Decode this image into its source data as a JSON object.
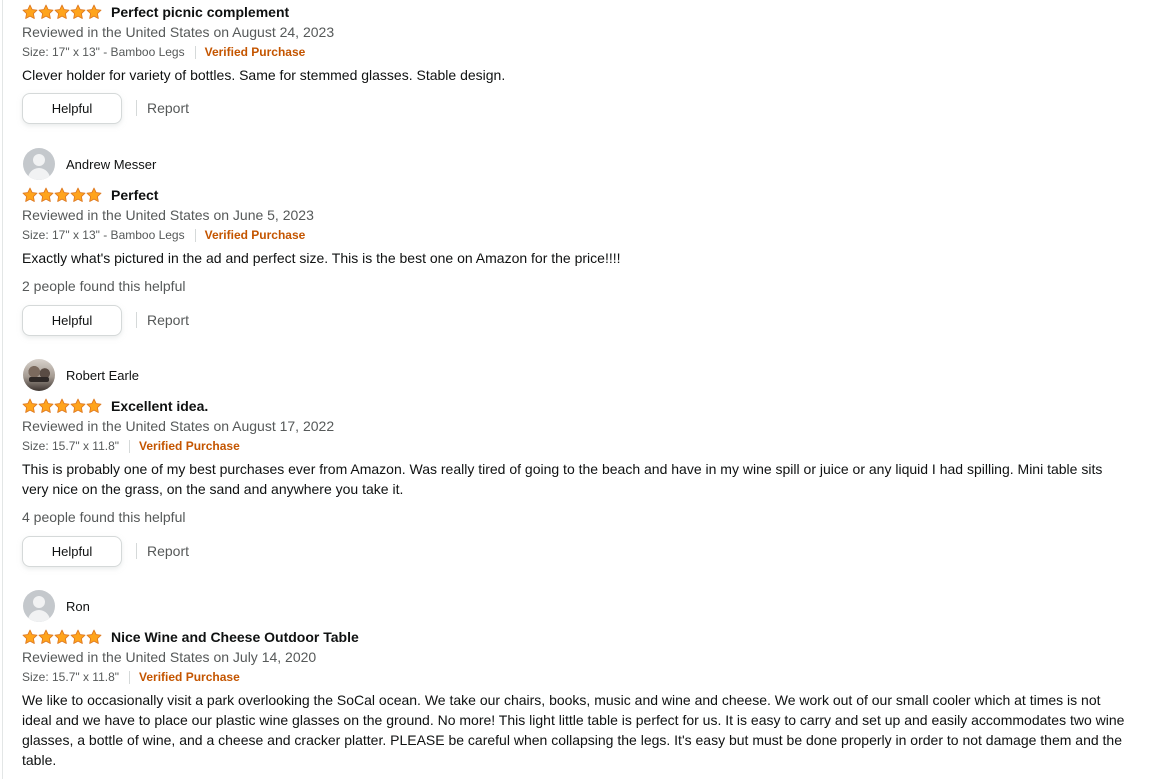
{
  "reviews": [
    {
      "title": "Perfect picnic complement",
      "date": "Reviewed in the United States on August 24, 2023",
      "size": "Size: 17\" x 13\" - Bamboo Legs",
      "verified": "Verified Purchase",
      "body": "Clever holder for variety of bottles. Same for stemmed glasses. Stable design.",
      "helpful_label": "Helpful",
      "report_label": "Report",
      "rating": 5
    },
    {
      "author": "Andrew Messer",
      "avatar": "default-avatar-icon",
      "title": "Perfect",
      "date": "Reviewed in the United States on June 5, 2023",
      "size": "Size: 17\" x 13\" - Bamboo Legs",
      "verified": "Verified Purchase",
      "body": "Exactly what's pictured in the ad and perfect size. This is the best one on Amazon for the price!!!!",
      "helpful_count": "2 people found this helpful",
      "helpful_label": "Helpful",
      "report_label": "Report",
      "rating": 5
    },
    {
      "author": "Robert Earle",
      "avatar": "photo-avatar",
      "title": "Excellent idea.",
      "date": "Reviewed in the United States on August 17, 2022",
      "size": "Size: 15.7\" x 11.8\"",
      "verified": "Verified Purchase",
      "body": "This is probably one of my best purchases ever from Amazon. Was really tired of going to the beach and have in my wine spill or juice or any liquid I had spilling. Mini table sits very nice on the grass, on the sand and anywhere you take it.",
      "helpful_count": "4 people found this helpful",
      "helpful_label": "Helpful",
      "report_label": "Report",
      "rating": 5
    },
    {
      "author": "Ron",
      "avatar": "default-avatar-icon",
      "title": "Nice Wine and Cheese Outdoor Table",
      "date": "Reviewed in the United States on July 14, 2020",
      "size": "Size: 15.7\" x 11.8\"",
      "verified": "Verified Purchase",
      "body": "We like to occasionally visit a park overlooking the SoCal ocean. We take our chairs, books, music and wine and cheese. We work out of our small cooler which at times is not ideal and we have to place our plastic wine glasses on the ground. No more! This light little table is perfect for us. It is easy to carry and set up and easily accommodates two wine glasses, a bottle of wine, and a cheese and cracker platter. PLEASE be careful when collapsing the legs. It's easy but must be done properly in order to not damage them and the table.",
      "rating": 5
    }
  ],
  "colors": {
    "star": "#ffa41c",
    "star_outline": "#de7921",
    "verified": "#c45500",
    "secondary_text": "#565959"
  }
}
